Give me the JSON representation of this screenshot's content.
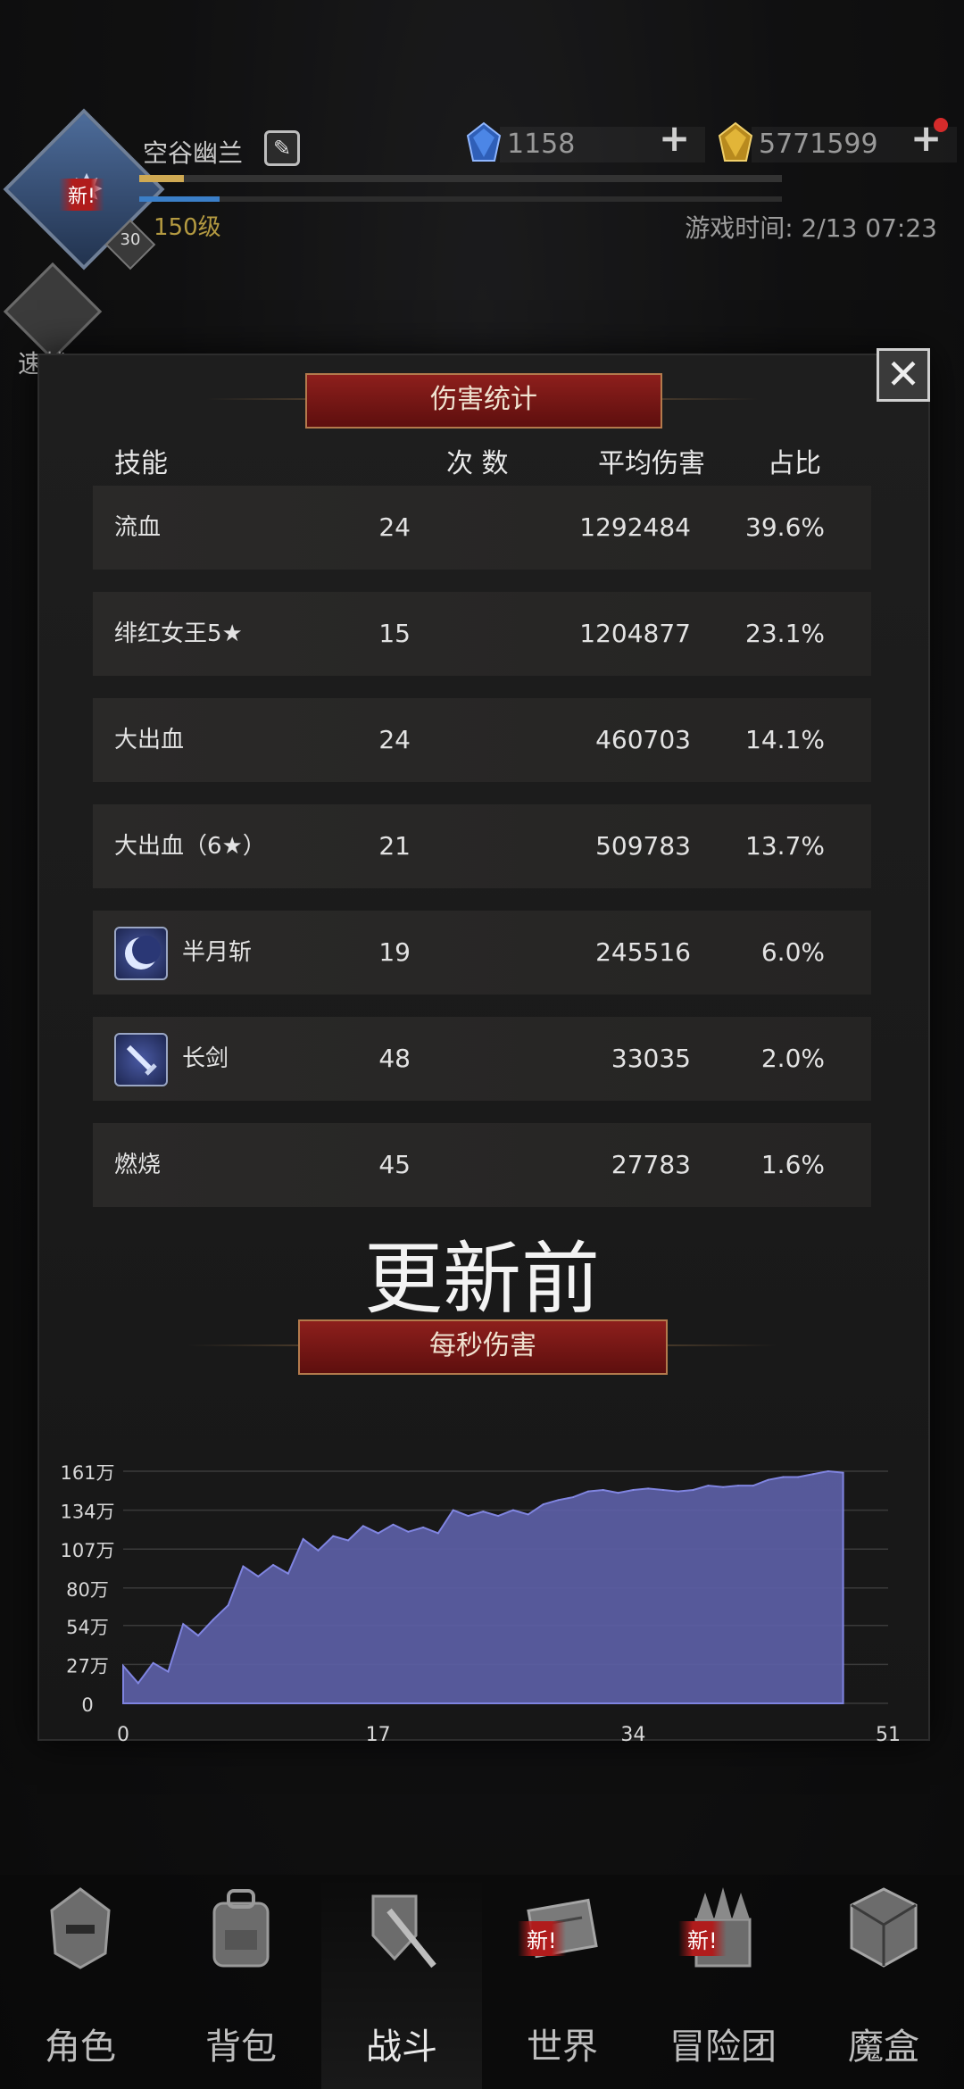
{
  "header": {
    "player_name": "空谷幽兰",
    "level_text": "150级",
    "avatar_new_tag": "新!",
    "avatar_level_badge": "30",
    "exp_progress": 0.07,
    "mp_progress": 0.125,
    "gems": "1158",
    "gold": "5771599",
    "game_time": "游戏时间: 2/13 07:23",
    "quick_battle_label": "速战"
  },
  "modal": {
    "title": "伤害统计",
    "columns": {
      "skill": "技能",
      "count": "次 数",
      "avg": "平均伤害",
      "share": "占比"
    },
    "rows": [
      {
        "skill": "流血",
        "count": "24",
        "avg": "1292484",
        "share": "39.6%",
        "icon": null
      },
      {
        "skill": "绯红女王5★",
        "count": "15",
        "avg": "1204877",
        "share": "23.1%",
        "icon": null
      },
      {
        "skill": "大出血",
        "count": "24",
        "avg": "460703",
        "share": "14.1%",
        "icon": null
      },
      {
        "skill": "大出血（6★）",
        "count": "21",
        "avg": "509783",
        "share": "13.7%",
        "icon": null
      },
      {
        "skill": "半月斩",
        "count": "19",
        "avg": "245516",
        "share": "6.0%",
        "icon": "crescent-moon-icon"
      },
      {
        "skill": "长剑",
        "count": "48",
        "avg": "33035",
        "share": "2.0%",
        "icon": "sword-icon"
      },
      {
        "skill": "燃烧",
        "count": "45",
        "avg": "27783",
        "share": "1.6%",
        "icon": null
      }
    ],
    "before_update_label": "更新前",
    "dps_title": "每秒伤害"
  },
  "chart_data": {
    "type": "area",
    "title": "每秒伤害",
    "ytick_labels": [
      "161万",
      "134万",
      "107万",
      "80万",
      "54万",
      "27万",
      "0"
    ],
    "yticks": [
      161,
      134,
      107,
      80,
      54,
      27,
      0
    ],
    "xticks": [
      0,
      17,
      34,
      51
    ],
    "xlim": [
      0,
      51
    ],
    "ylim": [
      0,
      161
    ],
    "y_unit": "万",
    "x": [
      0,
      1,
      2,
      3,
      4,
      5,
      6,
      7,
      8,
      9,
      10,
      11,
      12,
      13,
      14,
      15,
      16,
      17,
      18,
      19,
      20,
      21,
      22,
      23,
      24,
      25,
      26,
      27,
      28,
      29,
      30,
      31,
      32,
      33,
      34,
      35,
      36,
      37,
      38,
      39,
      40,
      41,
      42,
      43,
      44,
      45,
      46,
      47,
      48
    ],
    "values": [
      26,
      14,
      28,
      22,
      55,
      47,
      58,
      68,
      95,
      88,
      96,
      90,
      114,
      106,
      116,
      113,
      123,
      118,
      124,
      119,
      122,
      118,
      134,
      130,
      133,
      130,
      134,
      131,
      138,
      141,
      143,
      147,
      148,
      146,
      148,
      149,
      148,
      147,
      148,
      151,
      150,
      151,
      151,
      155,
      157,
      157,
      159,
      161,
      160
    ],
    "color": "#5c5fa6"
  },
  "nav": {
    "items": [
      {
        "label": "角色",
        "icon": "helmet-icon",
        "new": false
      },
      {
        "label": "背包",
        "icon": "backpack-icon",
        "new": false
      },
      {
        "label": "战斗",
        "icon": "sword-shield-icon",
        "new": false,
        "active": true
      },
      {
        "label": "世界",
        "icon": "scroll-map-icon",
        "new": true
      },
      {
        "label": "冒险团",
        "icon": "castle-icon",
        "new": true
      },
      {
        "label": "魔盒",
        "icon": "magic-cube-icon",
        "new": false
      }
    ],
    "new_tag": "新!"
  }
}
